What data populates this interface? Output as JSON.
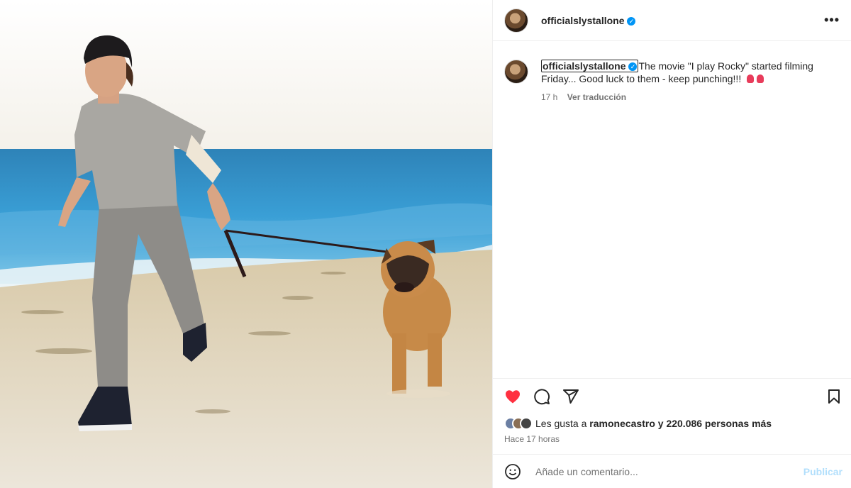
{
  "post": {
    "username": "officialslystallone",
    "verified_mark": "✓",
    "more_icon": "•••"
  },
  "caption": {
    "username": "officialslystallone",
    "text": "The movie \"I play Rocky\" started filming Friday... Good luck to them - keep punching!!!",
    "time": "17 h",
    "translate": "Ver traducción"
  },
  "likes": {
    "prefix": "Les gusta a ",
    "user": "ramonecastro",
    "suffix": " y 220.086 personas más"
  },
  "posted_ago": "Hace 17 horas",
  "comment_box": {
    "placeholder": "Añade un comentario...",
    "publish": "Publicar"
  },
  "colors": {
    "like_red": "#ff3040",
    "verified_blue": "#0095f6",
    "publish_disabled": "#b2dffc"
  },
  "icons": [
    "heart-icon",
    "comment-icon",
    "share-icon",
    "bookmark-icon",
    "emoji-icon",
    "more-icon",
    "verified-icon"
  ]
}
